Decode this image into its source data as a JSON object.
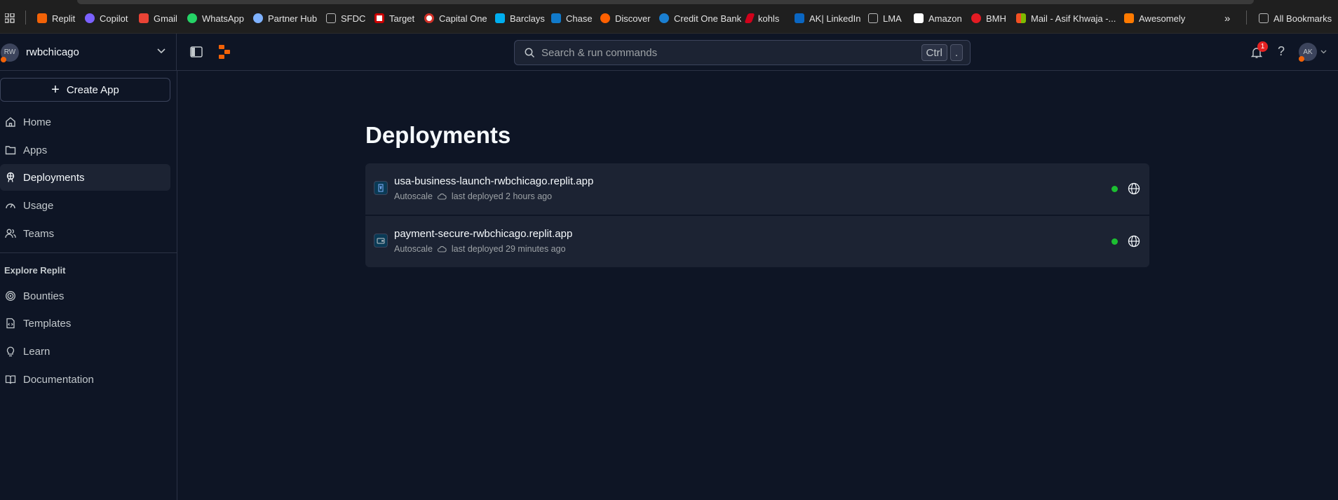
{
  "bookmarks": {
    "items": [
      {
        "label": "Replit",
        "color": "#f26207"
      },
      {
        "label": "Copilot",
        "color": "#7b61ff"
      },
      {
        "label": "Gmail",
        "color": "#ea4335"
      },
      {
        "label": "WhatsApp",
        "color": "#25d366"
      },
      {
        "label": "Partner Hub",
        "color": "#7fb2ff"
      },
      {
        "label": "SFDC",
        "color": "#aaaaaa"
      },
      {
        "label": "Target",
        "color": "#cc0000"
      },
      {
        "label": "Capital One",
        "color": "#d03027"
      },
      {
        "label": "Barclays",
        "color": "#00aeef"
      },
      {
        "label": "Chase",
        "color": "#117aca"
      },
      {
        "label": "Discover",
        "color": "#ff6000"
      },
      {
        "label": "Credit One Bank",
        "color": "#1a7fd1"
      },
      {
        "label": "kohls",
        "color": "#d0021b"
      },
      {
        "label": "AK| LinkedIn",
        "color": "#0a66c2"
      },
      {
        "label": "LMA",
        "color": "#aaaaaa"
      },
      {
        "label": "Amazon",
        "color": "#ffffff"
      },
      {
        "label": "BMH",
        "color": "#e31b23"
      },
      {
        "label": "Mail - Asif Khwaja -...",
        "color": "#f25022"
      },
      {
        "label": "Awesomely",
        "color": "#ff7a00"
      }
    ],
    "all_bookmarks": "All Bookmarks"
  },
  "team": {
    "avatar_initials": "RW",
    "name": "rwbchicago"
  },
  "search": {
    "placeholder": "Search & run commands",
    "kbd1": "Ctrl",
    "kbd2": "."
  },
  "header": {
    "notification_count": "1",
    "help": "?",
    "user_initials": "AK"
  },
  "sidebar": {
    "create_label": "Create App",
    "items": [
      {
        "label": "Home",
        "icon": "home-icon"
      },
      {
        "label": "Apps",
        "icon": "folder-icon"
      },
      {
        "label": "Deployments",
        "icon": "deployments-icon",
        "active": true
      },
      {
        "label": "Usage",
        "icon": "gauge-icon"
      },
      {
        "label": "Teams",
        "icon": "teams-icon"
      }
    ],
    "explore_heading": "Explore Replit",
    "explore_items": [
      {
        "label": "Bounties",
        "icon": "bounties-icon"
      },
      {
        "label": "Templates",
        "icon": "templates-icon"
      },
      {
        "label": "Learn",
        "icon": "lightbulb-icon"
      },
      {
        "label": "Documentation",
        "icon": "book-icon"
      }
    ]
  },
  "main": {
    "title": "Deployments",
    "deployments": [
      {
        "name": "usa-business-launch-rwbchicago.replit.app",
        "type": "Autoscale",
        "last_deployed": "last deployed 2 hours ago"
      },
      {
        "name": "payment-secure-rwbchicago.replit.app",
        "type": "Autoscale",
        "last_deployed": "last deployed 29 minutes ago"
      }
    ]
  },
  "colors": {
    "accent": "#f26207",
    "status_live": "#1cbf31",
    "background": "#0e1525"
  }
}
